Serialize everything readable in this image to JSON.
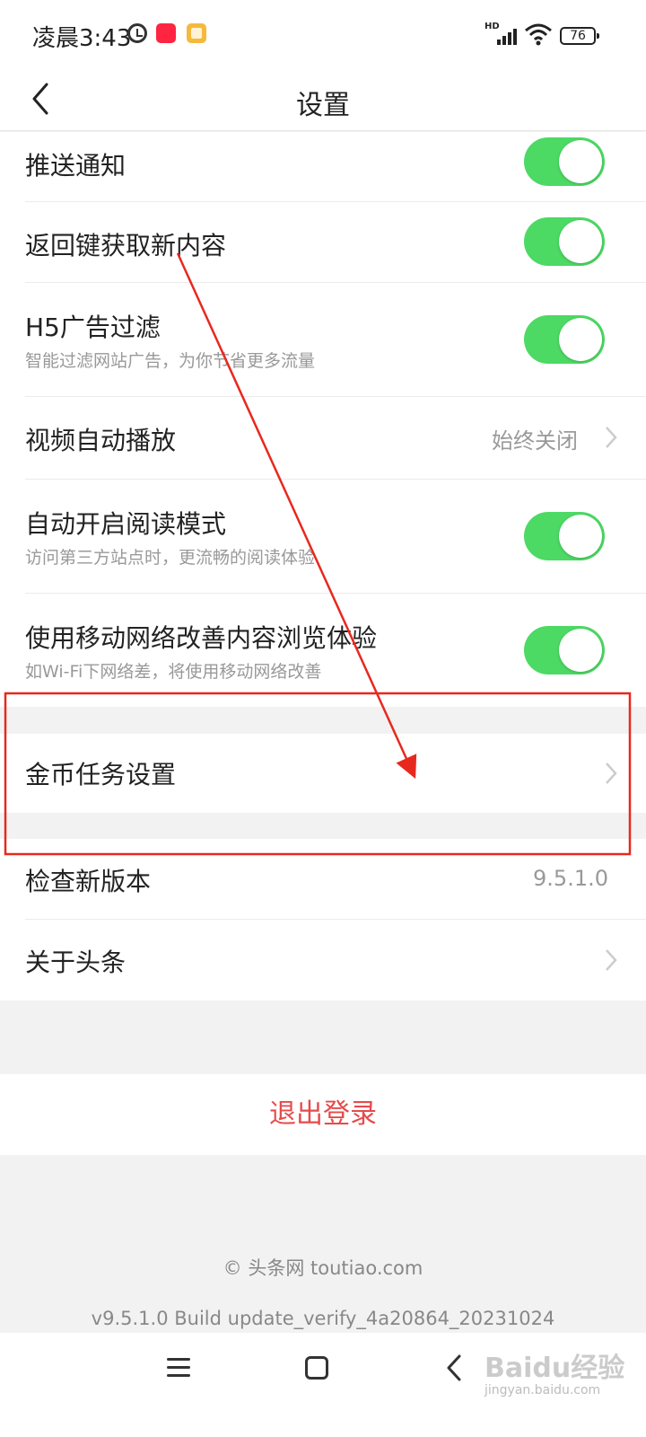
{
  "status_bar": {
    "time": "凌晨3:43",
    "signal_label": "HD",
    "battery": "76",
    "icons": [
      "alarm-icon",
      "xiaohongshu-app-icon",
      "notes-app-icon",
      "signal-icon",
      "wifi-icon",
      "battery-icon"
    ]
  },
  "nav": {
    "title": "设置",
    "back_icon": "chevron-left-icon"
  },
  "settings": {
    "push": {
      "label": "推送通知",
      "enabled": true
    },
    "back_refresh": {
      "label": "返回键获取新内容",
      "enabled": true
    },
    "h5_ad": {
      "label": "H5广告过滤",
      "sub": "智能过滤网站广告，为你节省更多流量",
      "enabled": true
    },
    "video_autoplay": {
      "label": "视频自动播放",
      "value": "始终关闭"
    },
    "reading_mode": {
      "label": "自动开启阅读模式",
      "sub": "访问第三方站点时，更流畅的阅读体验",
      "enabled": true
    },
    "mobile_net": {
      "label": "使用移动网络改善内容浏览体验",
      "sub": "如Wi-Fi下网络差，将使用移动网络改善",
      "enabled": true
    },
    "coin_task": {
      "label": "金币任务设置"
    },
    "check_version": {
      "label": "检查新版本",
      "value": "9.5.1.0"
    },
    "about": {
      "label": "关于头条"
    }
  },
  "logout_label": "退出登录",
  "footer": {
    "copyright": "© 头条网 toutiao.com",
    "build": "v9.5.1.0 Build update_verify_4a20864_20231024"
  },
  "watermark": {
    "brand": "Baidu经验",
    "url": "jingyan.baidu.com"
  },
  "colors": {
    "toggle_on": "#4cd964",
    "logout_text": "#e64b4b",
    "annotation": "#e8281e"
  }
}
